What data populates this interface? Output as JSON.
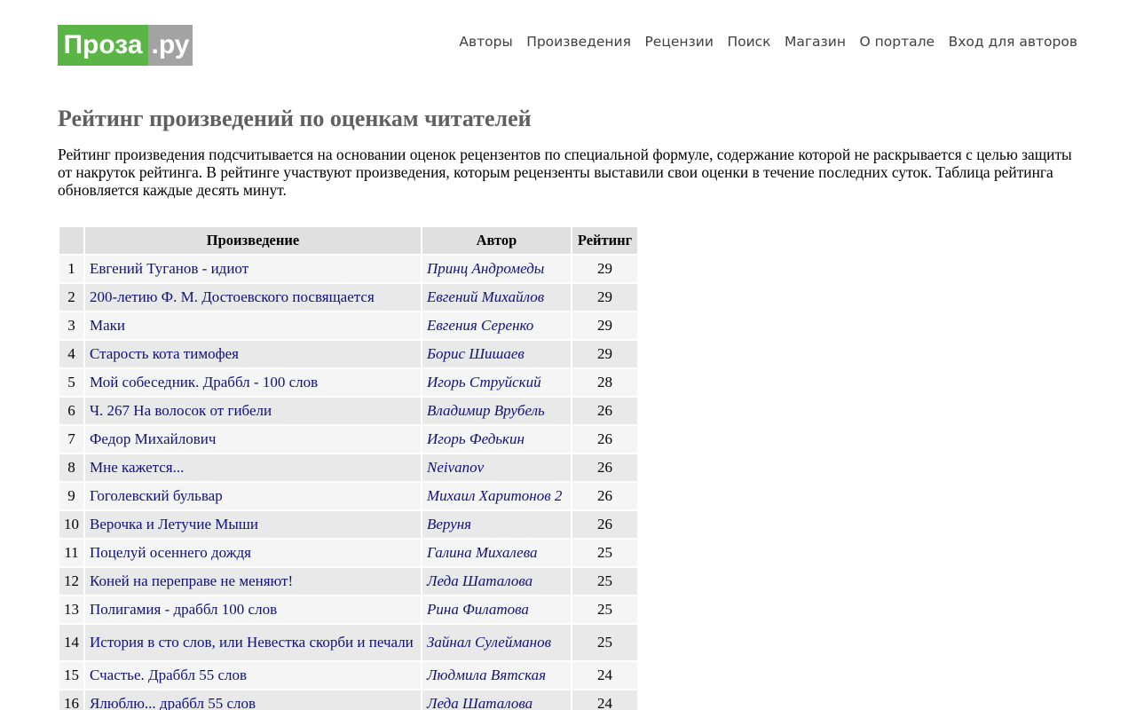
{
  "logo": {
    "left": "Проза",
    "right": ".ру"
  },
  "nav": [
    "Авторы",
    "Произведения",
    "Рецензии",
    "Поиск",
    "Магазин",
    "О портале",
    "Вход для авторов"
  ],
  "page_title": "Рейтинг произведений по оценкам читателей",
  "intro": "Рейтинг произведения подсчитывается на основании оценок рецензентов по специальной формуле, содержание которой не раскрывается с целью защиты от накруток рейтинга. В рейтинге участвуют произведения, которым рецензенты выставили свои оценки в течение последних суток. Таблица рейтинга обновляется каждые десять минут.",
  "table": {
    "headers": {
      "num": "",
      "work": "Произведение",
      "author": "Автор",
      "rating": "Рейтинг"
    },
    "rows": [
      {
        "num": "1",
        "work": "Евгений Туганов - идиот",
        "author": "Принц Андромеды",
        "rating": "29"
      },
      {
        "num": "2",
        "work": "200-летию Ф. М. Достоевского посвящается",
        "author": "Евгений Михайлов",
        "rating": "29"
      },
      {
        "num": "3",
        "work": "Маки",
        "author": "Евгения Серенко",
        "rating": "29"
      },
      {
        "num": "4",
        "work": "Старость кота тимофея",
        "author": "Борис Шишаев",
        "rating": "29"
      },
      {
        "num": "5",
        "work": "Мой собеседник. Драббл - 100 слов",
        "author": "Игорь Струйский",
        "rating": "28"
      },
      {
        "num": "6",
        "work": "Ч. 267 На волосок от гибели",
        "author": "Владимир Врубель",
        "rating": "26"
      },
      {
        "num": "7",
        "work": "Федор Михайлович",
        "author": "Игорь Федькин",
        "rating": "26"
      },
      {
        "num": "8",
        "work": "Мне кажется...",
        "author": "Neivanov",
        "rating": "26"
      },
      {
        "num": "9",
        "work": "Гоголевский бульвар",
        "author": "Михаил Харитонов 2",
        "rating": "26"
      },
      {
        "num": "10",
        "work": "Верочка и Летучие Мыши",
        "author": "Веруня",
        "rating": "26"
      },
      {
        "num": "11",
        "work": "Поцелуй осеннего дождя",
        "author": "Галина Михалева",
        "rating": "25"
      },
      {
        "num": "12",
        "work": "Коней на переправе не меняют!",
        "author": "Леда Шаталова",
        "rating": "25"
      },
      {
        "num": "13",
        "work": "Полигамия - драббл 100 слов",
        "author": "Рина Филатова",
        "rating": "25"
      },
      {
        "num": "14",
        "work": "История в сто слов, или Невестка скорби и печали",
        "author": "Зайнал Сулейманов",
        "rating": "25"
      },
      {
        "num": "15",
        "work": "Счастье. Драббл 55 слов",
        "author": "Людмила Вятская",
        "rating": "24"
      },
      {
        "num": "16",
        "work": "Ялюблю... драббл 55 слов",
        "author": "Леда Шаталова",
        "rating": "24"
      }
    ]
  }
}
